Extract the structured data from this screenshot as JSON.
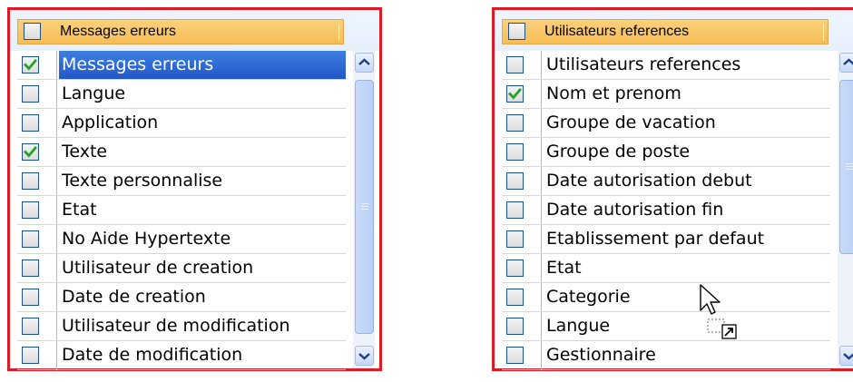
{
  "left_panel": {
    "header": {
      "title": "Messages erreurs",
      "checked": false
    },
    "rows": [
      {
        "label": "Messages erreurs",
        "checked": true,
        "selected": true
      },
      {
        "label": "Langue",
        "checked": false
      },
      {
        "label": "Application",
        "checked": false
      },
      {
        "label": "Texte",
        "checked": true
      },
      {
        "label": "Texte personnalise",
        "checked": false
      },
      {
        "label": "Etat",
        "checked": false
      },
      {
        "label": "No Aide Hypertexte",
        "checked": false
      },
      {
        "label": "Utilisateur de creation",
        "checked": false
      },
      {
        "label": "Date de creation",
        "checked": false
      },
      {
        "label": "Utilisateur de modification",
        "checked": false
      },
      {
        "label": "Date de modification",
        "checked": false
      }
    ]
  },
  "right_panel": {
    "header": {
      "title": "Utilisateurs references",
      "checked": false
    },
    "rows": [
      {
        "label": "Utilisateurs references",
        "checked": false
      },
      {
        "label": "Nom et prenom",
        "checked": true
      },
      {
        "label": "Groupe de vacation",
        "checked": false
      },
      {
        "label": "Groupe de poste",
        "checked": false
      },
      {
        "label": "Date autorisation debut",
        "checked": false
      },
      {
        "label": "Date autorisation fin",
        "checked": false
      },
      {
        "label": "Etablissement par defaut",
        "checked": false
      },
      {
        "label": "Etat",
        "checked": false
      },
      {
        "label": "Categorie",
        "checked": false
      },
      {
        "label": "Langue",
        "checked": false
      },
      {
        "label": "Gestionnaire",
        "checked": false
      }
    ]
  },
  "colors": {
    "panel_border": "#dd1a25",
    "header_bg": "#f7bd55",
    "selection": "#2f6bd6",
    "check": "#26a12b"
  },
  "icons": {
    "scroll_up": "chevron-up-icon",
    "scroll_down": "chevron-down-icon",
    "checkmark": "checkmark-icon",
    "cursor": "drag-shortcut-cursor-icon"
  }
}
